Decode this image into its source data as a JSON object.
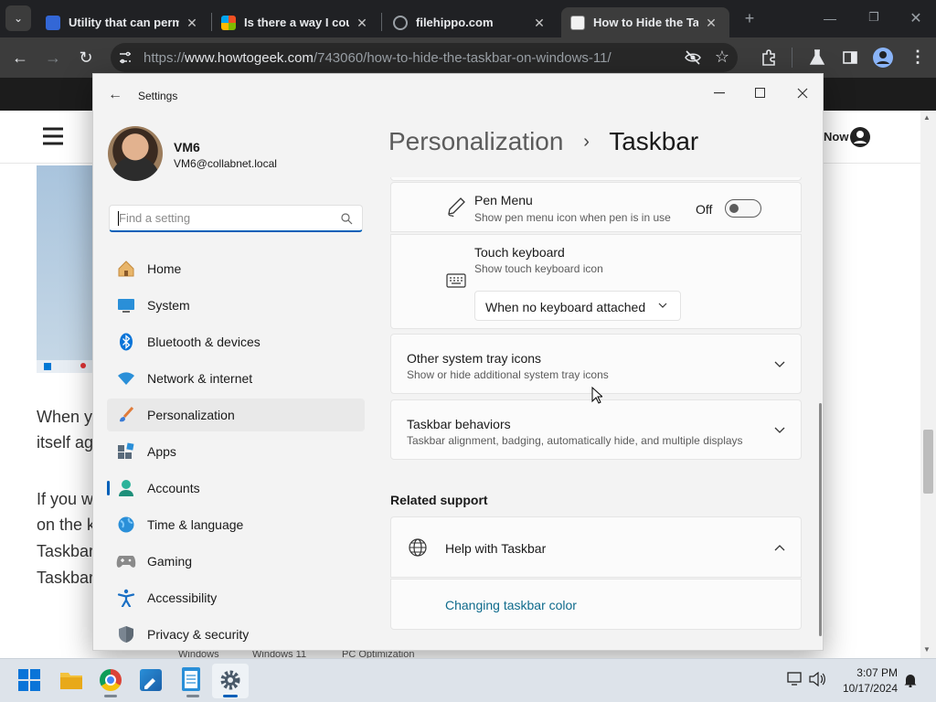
{
  "browser": {
    "tabs": [
      {
        "title": "Utility that can perma",
        "favicon_color": "#3367d6"
      },
      {
        "title": "Is there a way I could",
        "favicon_color": "#f25022"
      },
      {
        "title": "filehippo.com",
        "favicon_color": "#9aa0a6"
      },
      {
        "title": "How to Hide the Taskb",
        "favicon_color": "#f2f2f2"
      }
    ],
    "url_prefix": "https://",
    "url_domain": "www.howtogeek.com",
    "url_path": "/743060/how-to-hide-the-taskbar-on-windows-11/"
  },
  "webpage": {
    "now_label": "Now",
    "paragraph1": [
      "When yo",
      "itself ag"
    ],
    "paragraph2": [
      "If you w",
      "on the k",
      "Taskbar",
      "Taskbar"
    ],
    "footer_tags": [
      "Windows",
      "Windows 11",
      "PC Optimization"
    ]
  },
  "settings": {
    "window_title": "Settings",
    "user": {
      "name": "VM6",
      "email": "VM6@collabnet.local"
    },
    "search_placeholder": "Find a setting",
    "nav": [
      {
        "label": "Home",
        "icon": "home-icon"
      },
      {
        "label": "System",
        "icon": "system-icon"
      },
      {
        "label": "Bluetooth & devices",
        "icon": "bluetooth-icon"
      },
      {
        "label": "Network & internet",
        "icon": "wifi-icon"
      },
      {
        "label": "Personalization",
        "icon": "brush-icon",
        "selected": true
      },
      {
        "label": "Apps",
        "icon": "apps-icon"
      },
      {
        "label": "Accounts",
        "icon": "accounts-icon"
      },
      {
        "label": "Time & language",
        "icon": "globe-icon"
      },
      {
        "label": "Gaming",
        "icon": "gamepad-icon"
      },
      {
        "label": "Accessibility",
        "icon": "accessibility-icon"
      },
      {
        "label": "Privacy & security",
        "icon": "shield-icon"
      }
    ],
    "breadcrumb": {
      "parent": "Personalization",
      "sep": "›",
      "current": "Taskbar"
    },
    "pen_menu": {
      "title": "Pen Menu",
      "desc": "Show pen menu icon when pen is in use",
      "state": "Off"
    },
    "touch_keyboard": {
      "title": "Touch keyboard",
      "desc": "Show touch keyboard icon",
      "option": "When no keyboard attached"
    },
    "tray_icons": {
      "title": "Other system tray icons",
      "desc": "Show or hide additional system tray icons"
    },
    "behaviors": {
      "title": "Taskbar behaviors",
      "desc": "Taskbar alignment, badging, automatically hide, and multiple displays"
    },
    "related_support": "Related support",
    "help": {
      "title": "Help with Taskbar",
      "link": "Changing taskbar color"
    }
  },
  "taskbar": {
    "time": "3:07 PM",
    "date": "10/17/2024"
  },
  "colors": {
    "accent": "#005fb8",
    "link": "#0f6b8c"
  }
}
